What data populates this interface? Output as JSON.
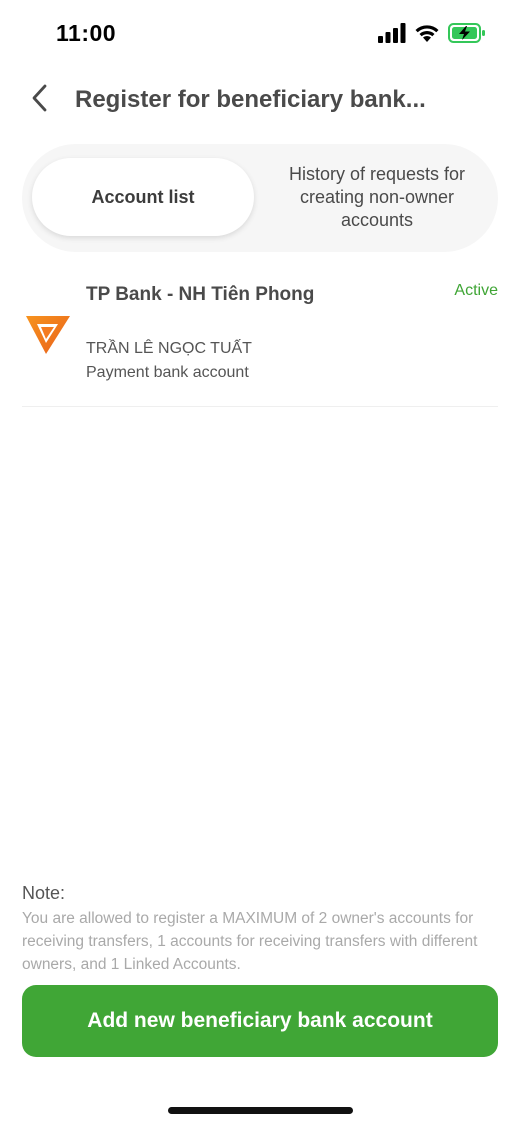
{
  "status_bar": {
    "time": "11:00",
    "icons": [
      "signal-icon",
      "wifi-icon",
      "battery-charging-icon"
    ],
    "battery_color": "#34c759"
  },
  "header": {
    "title": "Register for beneficiary bank...",
    "back_icon": "chevron-left-icon"
  },
  "tabs": [
    {
      "label": "Account list",
      "active": true
    },
    {
      "label": "History of requests for creating non-owner accounts",
      "active": false
    }
  ],
  "accounts": [
    {
      "bank_name": "TP Bank - NH Tiên Phong",
      "status": "Active",
      "holder_name": "TRẦN LÊ NGỌC TUẤT",
      "account_type": "Payment bank account",
      "logo_icon": "tpbank-logo-icon"
    }
  ],
  "note": {
    "title": "Note:",
    "text": "You are allowed to register a MAXIMUM of 2 owner's accounts for receiving transfers, 1 accounts for receiving transfers with different owners, and 1 Linked Accounts."
  },
  "actions": {
    "add_label": "Add new beneficiary bank account"
  },
  "colors": {
    "primary": "#40a636",
    "status_active": "#3fa535",
    "logo_orange": "#f47b20"
  }
}
